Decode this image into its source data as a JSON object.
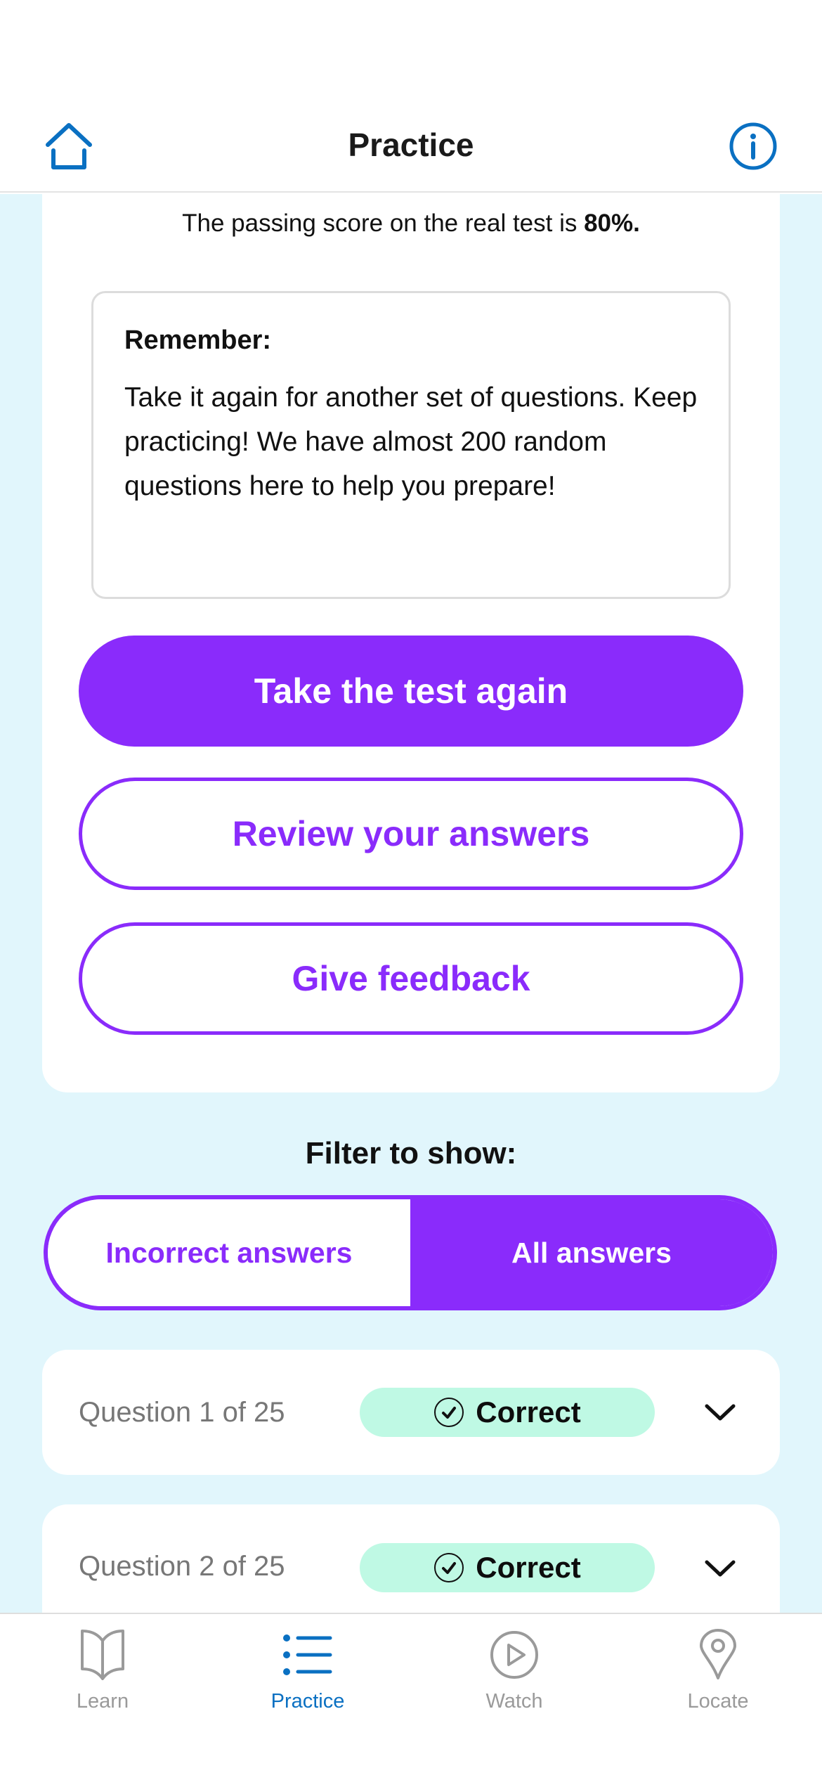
{
  "header": {
    "title": "Practice",
    "left_icon": "home-icon",
    "right_icon": "info-icon"
  },
  "result": {
    "passing_text": "The passing score on the real test is ",
    "passing_score": "80%.",
    "remember_title": "Remember:",
    "remember_body": "Take it again for another set of questions. Keep practicing! We have almost 200 random questions here to help you prepare!"
  },
  "actions": {
    "take_again": "Take the test again",
    "review": "Review your answers",
    "feedback": "Give feedback"
  },
  "filter": {
    "label": "Filter to show:",
    "options": [
      {
        "label": "Incorrect answers",
        "selected": false
      },
      {
        "label": "All answers",
        "selected": true
      }
    ]
  },
  "questions": [
    {
      "label": "Question 1 of 25",
      "status": "Correct",
      "status_icon": "check-circle-icon"
    },
    {
      "label": "Question 2 of 25",
      "status": "Correct",
      "status_icon": "check-circle-icon"
    }
  ],
  "tabbar": {
    "items": [
      {
        "label": "Learn",
        "icon": "book-icon",
        "active": false
      },
      {
        "label": "Practice",
        "icon": "list-icon",
        "active": true
      },
      {
        "label": "Watch",
        "icon": "play-circle-icon",
        "active": false
      },
      {
        "label": "Locate",
        "icon": "map-pin-icon",
        "active": false
      }
    ]
  },
  "colors": {
    "accent_purple": "#8a2bfb",
    "nav_blue": "#0a70c2",
    "background_light_blue": "#e1f6fc",
    "correct_badge": "#bff9e4",
    "inactive_gray": "#9a9a9a"
  }
}
